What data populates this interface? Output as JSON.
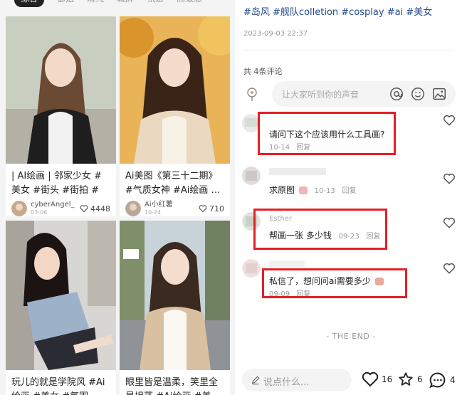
{
  "feed": {
    "tabs": [
      "综合",
      "御姐",
      "清纯",
      "城屏",
      "氛感",
      "高级感"
    ],
    "cards": [
      {
        "title": "| AI绘画 | 邻家少女 #美女 #街头 #街拍 #邻…",
        "author": "cyberAngel_",
        "date": "03-06",
        "likes": "4448"
      },
      {
        "title": "Ai美图《第三十二期》 #气质女神 #Ai绘画 …",
        "author": "Ai小红薯",
        "date": "10-24",
        "likes": "710"
      },
      {
        "title": "玩儿的就是学院风 #Ai绘画 #美女 #氛围…",
        "author": "",
        "date": "",
        "likes": ""
      },
      {
        "title": "眼里皆是温柔，笑里全是坦荡 #Ai绘画 #美…",
        "author": "",
        "date": "",
        "likes": ""
      }
    ]
  },
  "post": {
    "tags": "#岛风 #舰队colletion #cosplay #ai #美女",
    "date": "2023-09-03 22:37",
    "comment_count": "共 4条评论",
    "input_placeholder": "让大家听到你的声音"
  },
  "comments": [
    {
      "name": "",
      "text": "请问下这个应该用什么工具画?",
      "date": "10-14",
      "reply": "回复"
    },
    {
      "name": "",
      "text": "求原图",
      "date": "10-13",
      "reply": "回复"
    },
    {
      "name": "Esther",
      "text": "帮画一张 多少钱",
      "date": "09-23",
      "reply": "回复"
    },
    {
      "name": "",
      "text": "私信了，想问问ai需要多少",
      "date": "09-09",
      "reply": "回复"
    }
  ],
  "end_text": "- THE END -",
  "bottom_bar": {
    "placeholder": "说点什么...",
    "likes": "16",
    "stars": "6",
    "comments": "4"
  },
  "colors": {
    "tag": "#234b8f",
    "highlight": "#e41f26",
    "background": "#f4f4f4"
  },
  "icons": [
    "location-pin-icon",
    "at-icon",
    "emoji-icon",
    "image-icon",
    "heart-icon",
    "star-icon",
    "chat-bubble-icon",
    "pen-icon"
  ]
}
